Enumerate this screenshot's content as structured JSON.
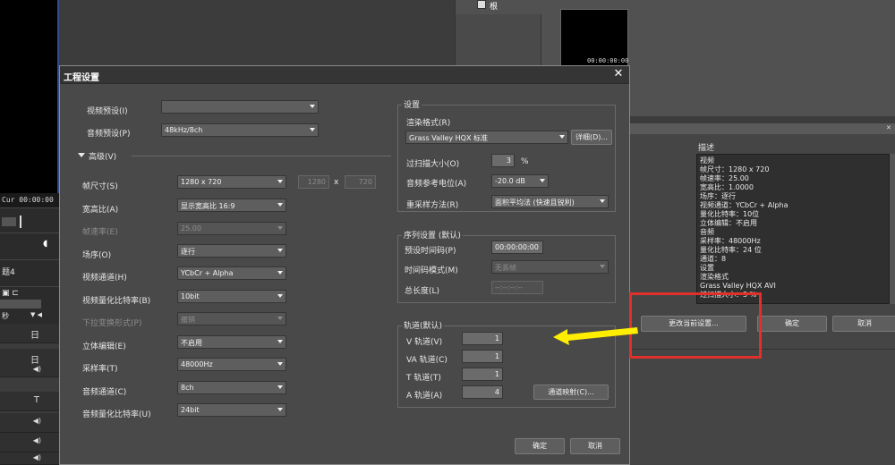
{
  "background": {
    "timecode_row": "Cur 00:00:00",
    "panel_icon_label": "根",
    "thumbnail_timecode": "00:00:00:00",
    "left_panel_label": "题4",
    "left_dropdown_label": "秒",
    "track_glyphs": [
      "日",
      "日",
      "T"
    ],
    "description": {
      "label": "描述",
      "lines": [
        "视频",
        "  帧尺寸：1280 x 720",
        "  帧速率：25.00",
        "  宽高比：1.0000",
        "  场序：逐行",
        "  视频通道：YCbCr + Alpha",
        "  量化比特率：10位",
        "  立体编辑：不启用",
        "音频",
        "  采样率：48000Hz",
        "  量化比特率：24 位",
        "  通道：8",
        "设置",
        "  渲染格式",
        "  Grass Valley HQX AVI",
        "  过扫描大小：3 %"
      ]
    },
    "buttons": {
      "change_current": "更改当前设置...",
      "ok": "确定",
      "cancel": "取消"
    }
  },
  "dialog": {
    "title": "工程设置",
    "video_preset_label": "视频预设(I)",
    "video_preset_value": "",
    "audio_preset_label": "音频预设(P)",
    "audio_preset_value": "48kHz/8ch",
    "advanced_label": "高级(V)",
    "frame_size": {
      "label": "帧尺寸(S)",
      "value": "1280 x 720",
      "w": "1280",
      "x": "x",
      "h": "720"
    },
    "aspect": {
      "label": "宽高比(A)",
      "value": "显示宽高比 16:9"
    },
    "frame_rate": {
      "label": "帧速率(E)",
      "value": "25.00"
    },
    "field_order": {
      "label": "场序(O)",
      "value": "逐行"
    },
    "video_channel": {
      "label": "视频通道(H)",
      "value": "YCbCr + Alpha"
    },
    "video_bitdepth": {
      "label": "视频量化比特率(B)",
      "value": "10bit"
    },
    "pulldown": {
      "label": "下拉变换形式(P)",
      "value": "撤销"
    },
    "stereo": {
      "label": "立体编辑(E)",
      "value": "不启用"
    },
    "sample_rate": {
      "label": "采样率(T)",
      "value": "48000Hz"
    },
    "audio_channel": {
      "label": "音频通道(C)",
      "value": "8ch"
    },
    "audio_bitdepth": {
      "label": "音频量化比特率(U)",
      "value": "24bit"
    },
    "settings": {
      "group_title": "设置",
      "render_format_label": "渲染格式(R)",
      "render_format_value": "Grass Valley HQX 标准",
      "details_button": "详细(D)...",
      "overscan_label": "过扫描大小(O)",
      "overscan_value": "3",
      "overscan_unit": "%",
      "audio_ref_label": "音频参考电位(A)",
      "audio_ref_value": "-20.0 dB",
      "resample_label": "重采样方法(R)",
      "resample_value": "面积平均法 (快速且锐利)"
    },
    "sequence": {
      "group_title": "序列设置 (默认)",
      "preset_tc_label": "预设时间码(P)",
      "preset_tc_value": "00:00:00:00",
      "tc_mode_label": "时间码模式(M)",
      "tc_mode_value": "无丢帧",
      "total_length_label": "总长度(L)",
      "total_length_value": "--:--:--:--"
    },
    "tracks": {
      "group_title": "轨道(默认)",
      "v_label": "V 轨道(V)",
      "v_value": "1",
      "va_label": "VA 轨道(C)",
      "va_value": "1",
      "t_label": "T 轨道(T)",
      "t_value": "1",
      "a_label": "A 轨道(A)",
      "a_value": "4",
      "channel_map_button": "通道映射(C)..."
    },
    "ok_button": "确定",
    "cancel_button": "取消"
  },
  "colors": {
    "dialog_bg": "#494949",
    "annotation_red": "#e0302a",
    "annotation_arrow": "#ffee00"
  }
}
